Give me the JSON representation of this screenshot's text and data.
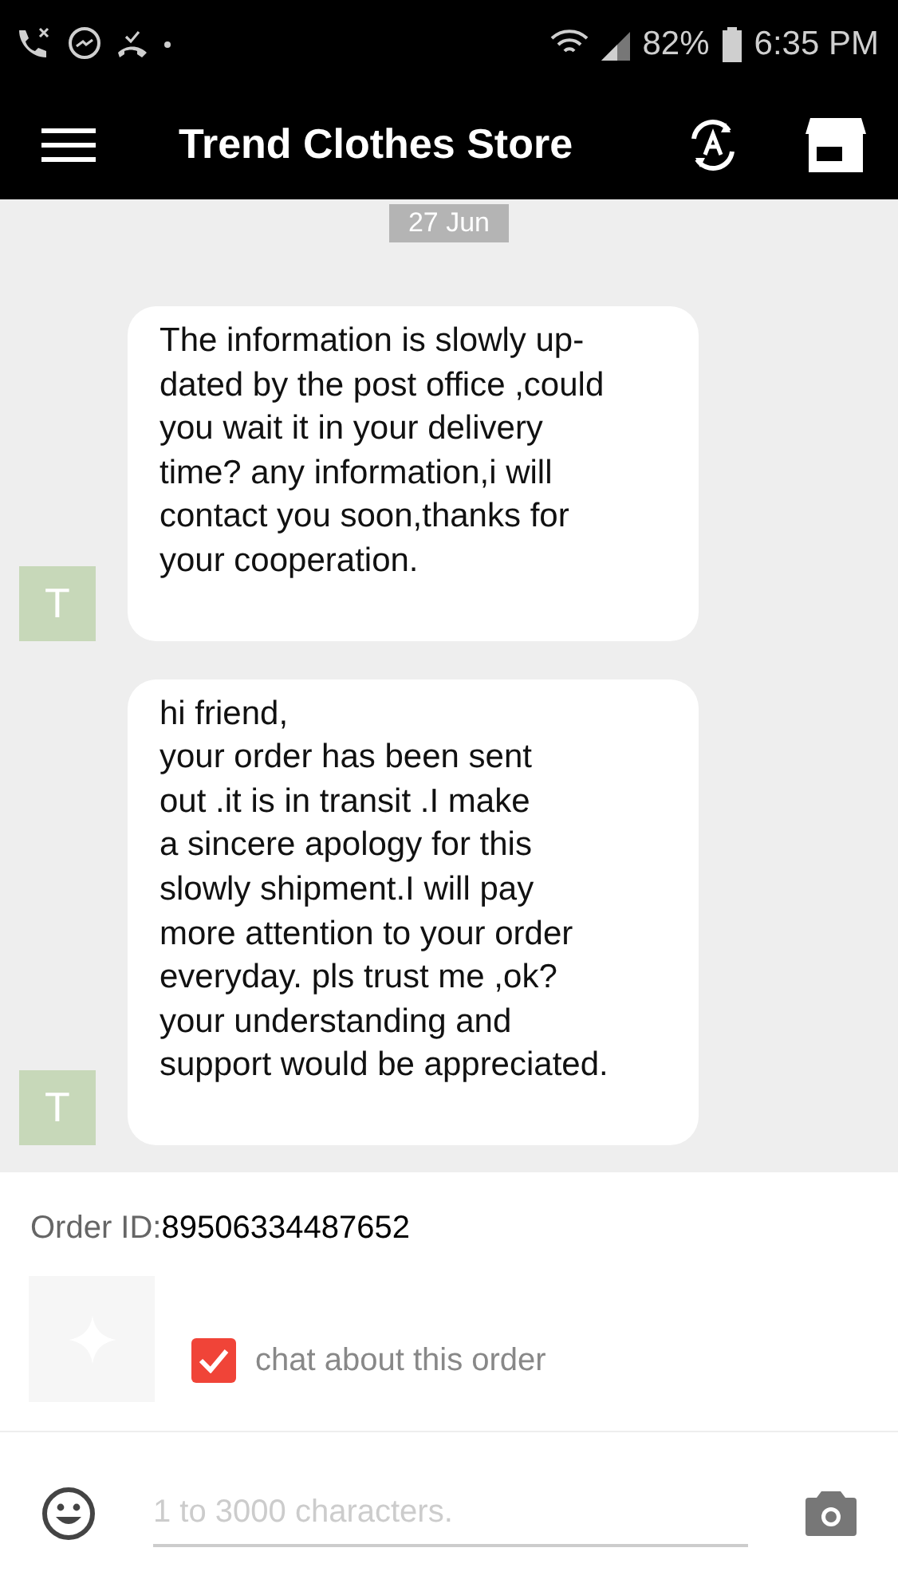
{
  "status_bar": {
    "battery": "82%",
    "time": "6:35 PM"
  },
  "app_bar": {
    "title": "Trend Clothes Store"
  },
  "date_label": "27 Jun",
  "messages": [
    {
      "avatar": "T",
      "lines": [
        "The information  is slowly up-",
        "dated by the post office ,could",
        "you wait it in your delivery",
        "time? any information,i will",
        "contact you soon,thanks for",
        "your cooperation."
      ]
    },
    {
      "avatar": "T",
      "lines": [
        "hi friend,",
        "your  order has been sent",
        "out .it is in transit .I make",
        "a sincere apology for this",
        "slowly shipment.I  will pay",
        "more attention to your order",
        "everyday. pls  trust me ,ok?",
        "your understanding and",
        "support would be appreciated."
      ]
    }
  ],
  "order": {
    "label": "Order ID:",
    "id": "89506334487652",
    "chat_about": {
      "label": "chat about this order",
      "checked": true
    }
  },
  "composer": {
    "placeholder": "1 to 3000 characters."
  }
}
